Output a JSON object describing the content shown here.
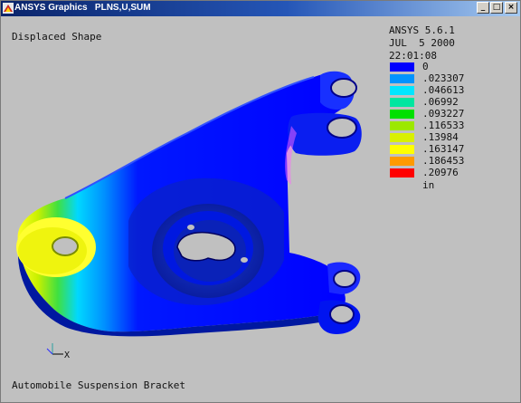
{
  "window": {
    "title": "ANSYS Graphics   PLNS,U,SUM",
    "minimize_symbol": "_",
    "maximize_symbol": "□",
    "close_symbol": "×"
  },
  "plot": {
    "heading": "Displaced Shape",
    "caption": "Automobile Suspension Bracket",
    "triad_x_label": "X"
  },
  "info": {
    "product": "ANSYS 5.6.1",
    "date": "JUL  5 2000",
    "time": "22:01:08"
  },
  "legend": {
    "unit": "in",
    "levels": [
      {
        "value": "0",
        "color": "#0000ff"
      },
      {
        "value": ".023307",
        "color": "#0093ff"
      },
      {
        "value": ".046613",
        "color": "#00e6ff"
      },
      {
        "value": ".06992",
        "color": "#00e6a0"
      },
      {
        "value": ".093227",
        "color": "#00e000"
      },
      {
        "value": ".116533",
        "color": "#9ce800"
      },
      {
        "value": ".13984",
        "color": "#d9f000"
      },
      {
        "value": ".163147",
        "color": "#ffff00"
      },
      {
        "value": ".186453",
        "color": "#ff9a00"
      },
      {
        "value": ".20976",
        "color": "#ff0000"
      }
    ]
  }
}
